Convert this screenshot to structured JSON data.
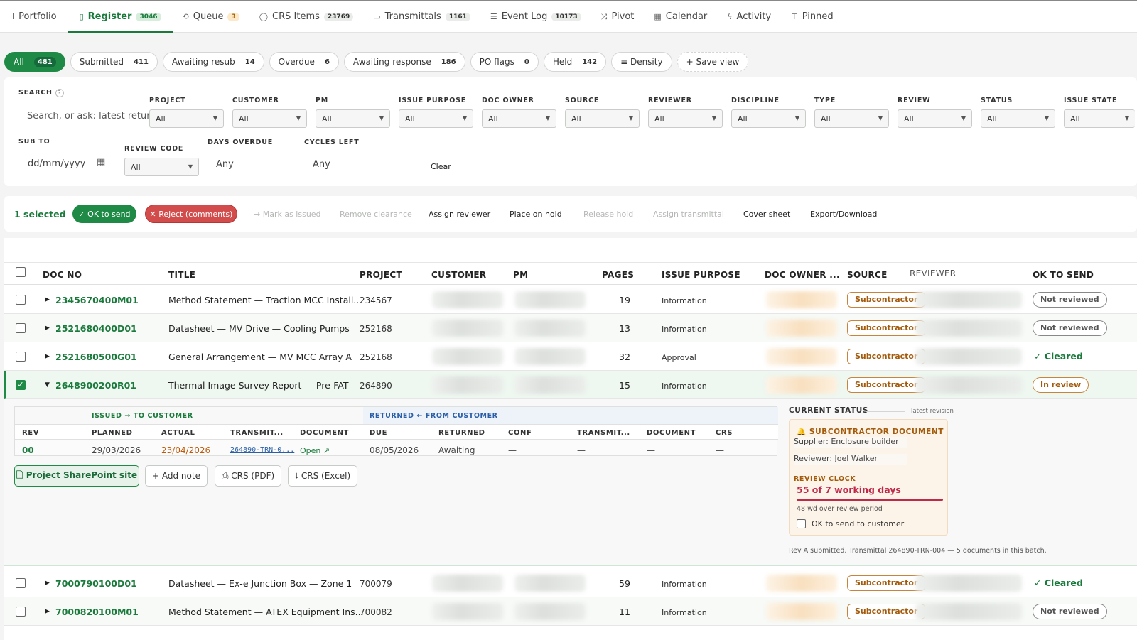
{
  "nav": {
    "tabs": [
      {
        "label": "Portfolio",
        "icon": "bar-chart-icon",
        "count": ""
      },
      {
        "label": "Register",
        "icon": "clipboard-icon",
        "count": "3046"
      },
      {
        "label": "Queue",
        "icon": "queue-icon",
        "count": "3"
      },
      {
        "label": "CRS Items",
        "icon": "comment-icon",
        "count": "23769"
      },
      {
        "label": "Transmittals",
        "icon": "transmittal-icon",
        "count": "1161"
      },
      {
        "label": "Event Log",
        "icon": "log-icon",
        "count": "10173"
      },
      {
        "label": "Pivot",
        "icon": "pivot-icon",
        "count": ""
      },
      {
        "label": "Calendar",
        "icon": "calendar-icon",
        "count": ""
      },
      {
        "label": "Activity",
        "icon": "bolt-icon",
        "count": ""
      },
      {
        "label": "Pinned",
        "icon": "pin-icon",
        "count": ""
      }
    ]
  },
  "chips": [
    {
      "label": "All",
      "count": "481"
    },
    {
      "label": "Submitted",
      "count": "411"
    },
    {
      "label": "Awaiting resub",
      "count": "14"
    },
    {
      "label": "Overdue",
      "count": "6"
    },
    {
      "label": "Awaiting response",
      "count": "186"
    },
    {
      "label": "PO flags",
      "count": "0"
    },
    {
      "label": "Held",
      "count": "142"
    },
    {
      "label": "≡ Density",
      "count": ""
    },
    {
      "label": "+ Save view",
      "count": ""
    }
  ],
  "search": {
    "label": "SEARCH",
    "help": "?",
    "placeholder": "Search, or ask: latest retur",
    "columns": [
      {
        "label": "PROJECT",
        "value": "All"
      },
      {
        "label": "CUSTOMER",
        "value": "All"
      },
      {
        "label": "PM",
        "value": "All"
      },
      {
        "label": "ISSUE PURPOSE",
        "value": "All"
      },
      {
        "label": "DOC OWNER",
        "value": "All"
      },
      {
        "label": "SOURCE",
        "value": "All"
      },
      {
        "label": "REVIEWER",
        "value": "All"
      },
      {
        "label": "DISCIPLINE",
        "value": "All"
      },
      {
        "label": "TYPE",
        "value": "All"
      },
      {
        "label": "REVIEW",
        "value": "All"
      },
      {
        "label": "STATUS",
        "value": "All"
      },
      {
        "label": "ISSUE STATE",
        "value": "All"
      }
    ],
    "sub_to_label": "SUB TO",
    "sub_to_value": "dd/mm/yyyy",
    "review_code_label": "REVIEW CODE",
    "review_code_value": "All",
    "days_overdue_label": "DAYS OVERDUE",
    "days_overdue_value": "Any",
    "cycles_left_label": "CYCLES LEFT",
    "cycles_left_value": "Any",
    "clear": "Clear"
  },
  "actions": {
    "selected": "1 selected",
    "ok": "✓ OK to send",
    "reject": "✕ Reject (comments)",
    "mark": "→ Mark as issued",
    "remove": "Remove clearance",
    "assign": "Assign reviewer",
    "hold": "Place on hold",
    "release": "Release hold",
    "assign_t": "Assign transmittal",
    "cover": "Cover sheet",
    "export": "Export/Download"
  },
  "columns": {
    "doc": "DOC NO",
    "title": "TITLE",
    "project": "PROJECT",
    "customer": "CUSTOMER",
    "pm": "PM",
    "pages": "PAGES",
    "purpose": "ISSUE PURPOSE",
    "owner": "DOC OWNER ...",
    "source": "SOURCE",
    "reviewer": "REVIEWER",
    "ok": "OK TO SEND"
  },
  "rows": [
    {
      "doc": "2345670400M01",
      "title": "Method Statement — Traction MCC Install...",
      "project": "234567",
      "pages": "19",
      "purpose": "Information",
      "source": "Subcontractor",
      "ok": "Not reviewed"
    },
    {
      "doc": "2521680400D01",
      "title": "Datasheet — MV Drive — Cooling Pumps",
      "project": "252168",
      "pages": "13",
      "purpose": "Information",
      "source": "Subcontractor",
      "ok": "Not reviewed"
    },
    {
      "doc": "2521680500G01",
      "title": "General Arrangement — MV MCC Array A",
      "project": "252168",
      "pages": "32",
      "purpose": "Approval",
      "source": "Subcontractor",
      "ok": "✓ Cleared"
    },
    {
      "doc": "2648900200R01",
      "title": "Thermal Image Survey Report — Pre-FAT",
      "project": "264890",
      "pages": "15",
      "purpose": "Information",
      "source": "Subcontractor",
      "ok": "In review"
    },
    {
      "doc": "7000790100D01",
      "title": "Datasheet — Ex-e Junction Box — Zone 1",
      "project": "700079",
      "pages": "59",
      "purpose": "Information",
      "source": "Subcontractor",
      "ok": "✓ Cleared"
    },
    {
      "doc": "7000820100M01",
      "title": "Method Statement — ATEX Equipment Ins...",
      "project": "700082",
      "pages": "11",
      "purpose": "Information",
      "source": "Subcontractor",
      "ok": "Not reviewed"
    }
  ],
  "detail": {
    "issued": "ISSUED → TO CUSTOMER",
    "returned": "RETURNED ← FROM CUSTOMER",
    "h": {
      "rev": "REV",
      "planned": "PLANNED",
      "actual": "ACTUAL",
      "transmit": "TRANSMIT...",
      "document": "DOCUMENT",
      "due": "DUE",
      "returned": "RETURNED",
      "conf": "CONF",
      "transmit2": "TRANSMIT...",
      "document2": "DOCUMENT",
      "crs": "CRS"
    },
    "v": {
      "rev": "00",
      "planned": "29/03/2026",
      "actual": "23/04/2026",
      "transmit": "264890-TRN-0...",
      "document": "Open ↗",
      "due": "08/05/2026",
      "returned": "Awaiting",
      "conf": "—",
      "transmit2": "—",
      "document2": "—",
      "crs": "—"
    },
    "buttons": {
      "sharepoint": "🗋 Project SharePoint site",
      "note": "+ Add note",
      "crs_pdf": "⎙ CRS (PDF)",
      "crs_xls": "⤓ CRS (Excel)"
    },
    "status": {
      "title": "CURRENT STATUS",
      "sub": "latest revision",
      "doc_type": "🔔 SUBCONTRACTOR DOCUMENT",
      "supplier": "Supplier: Enclosure builder",
      "reviewer": "Reviewer: Joel Walker",
      "clock_label": "REVIEW CLOCK",
      "clock_value": "55 of 7 working days",
      "clock_fraction": 1.0,
      "over": "48 wd over review period",
      "ok_send": "OK to send to customer"
    },
    "footnote": "Rev A submitted. Transmittal 264890-TRN-004 — 5 documents in this batch."
  },
  "colors": {
    "accent": "#1f8a45",
    "danger": "#d24c4c",
    "warning": "#c8843b",
    "clock": "#c0284a"
  }
}
